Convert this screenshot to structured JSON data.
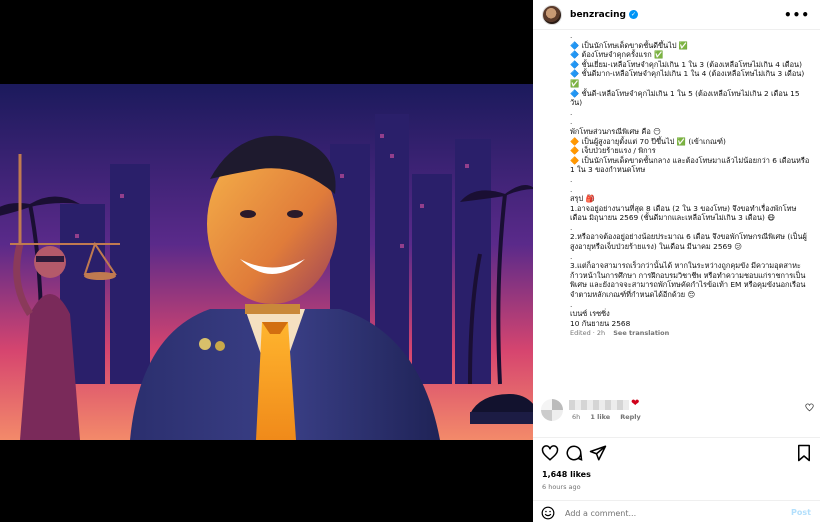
{
  "post": {
    "username": "benzracing",
    "verified_mark": "✓",
    "more_label": "•••",
    "caption_lines": [
      ".",
      "🔷 เป็นนักโทษเด็ดขาดชั้นดีขึ้นไป ✅",
      "🔷 ต้องโทษจำคุกครั้งแรก ✅",
      "🔷 ชั้นเยี่ยม-เหลือโทษจำคุกไม่เกิน 1 ใน 3 (ต้องเหลือโทษไม่เกิน 4 เดือน)",
      "🔷 ชั้นดีมาก-เหลือโทษจำคุกไม่เกิน 1 ใน 4 (ต้องเหลือโทษไม่เกิน 3 เดือน) ✅",
      "🔷 ชั้นดี-เหลือโทษจำคุกไม่เกิน 1 ใน 5 (ต้องเหลือโทษไม่เกิน 2 เดือน 15 วัน)",
      ".",
      ".",
      "พักโทษส่วนกรณีพิเศษ คือ 😶",
      "🔶 เป็นผู้สูงอายุตั้งแต่ 70 ปีขึ้นไป ✅ (เข้าเกณฑ์)",
      "🔶 เจ็บป่วยร้ายแรง / พิการ",
      "🔶 เป็นนักโทษเด็ดขาดชั้นกลาง และต้องโทษมาแล้วไม่น้อยกว่า 6 เดือนหรือ 1 ใน 3 ของกำหนดโทษ",
      ".",
      ".",
      "สรุป 🎒",
      "1.อาจอยู่อย่างนานที่สุด 8 เดือน (2 ใน 3 ของโทษ) จึงขอทำเรื่องพักโทษเดือน มิถุนายน 2569 (ชั้นดีมากและเหลือโทษไม่เกิน 3 เดือน) 😷",
      ".",
      "2.หรืออาจต้องอยู่อย่างน้อยประมาณ 6 เดือน จึงขอพักโทษกรณีพิเศษ (เป็นผู้สูงอายุหรือเจ็บป่วยร้ายแรง) ในเดือน มีนาคม 2569 😕",
      ".",
      "3.แต่ก็อาจสามารถเร็วกว่านั้นได้ หากในระหว่างถูกคุมขัง มีความอุตสาหะก้าวหน้าในการศึกษา การฝึกอบรมวิชาชีพ หรือทำความชอบแก่ราชการเป็นพิเศษ และยังอาจจะสามารถพักโทษคัดกำไรข้อเท้า EM หรือคุมขังนอกเรือนจำตามหลักเกณฑ์ที่กำหนดได้อีกด้วย 😔",
      ".",
      "เบนซ์ เรซซิ่ง",
      "10 กันยายน 2568"
    ],
    "edited_label": "Edited · 2h",
    "see_translation": "See translation"
  },
  "comment": {
    "heart": "❤",
    "age": "6h",
    "likes": "1 like",
    "reply": "Reply"
  },
  "footer": {
    "likes": "1,648 likes",
    "time": "6 hours ago",
    "add_comment_placeholder": "Add a comment...",
    "post_label": "Post"
  },
  "colors": {
    "verified": "#0095f6",
    "post_button": "#b2dffc",
    "heart": "#d0021b"
  }
}
